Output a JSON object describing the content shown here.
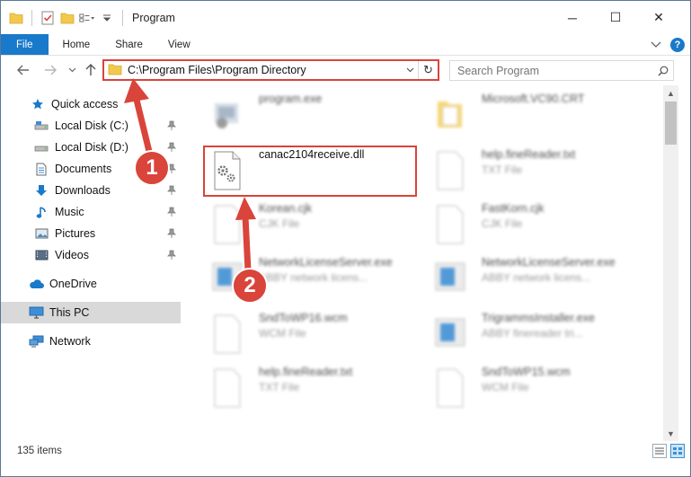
{
  "window": {
    "title": "Program",
    "controls": {
      "minimize": "─",
      "maximize": "☐",
      "close": "✕"
    }
  },
  "ribbon": {
    "tabs": [
      {
        "label": "File"
      },
      {
        "label": "Home"
      },
      {
        "label": "Share"
      },
      {
        "label": "View"
      }
    ]
  },
  "address": {
    "path": "C:\\Program Files\\Program Directory",
    "refresh_glyph": "↻"
  },
  "search": {
    "placeholder": "Search Program"
  },
  "sidebar": {
    "items": [
      {
        "label": "Quick access",
        "icon": "star-icon",
        "pinned": false
      },
      {
        "label": "Local Disk (C:)",
        "icon": "drive-icon",
        "pinned": true
      },
      {
        "label": "Local Disk (D:)",
        "icon": "drive-icon",
        "pinned": true
      },
      {
        "label": "Documents",
        "icon": "documents-icon",
        "pinned": true
      },
      {
        "label": "Downloads",
        "icon": "download-icon",
        "pinned": true
      },
      {
        "label": "Music",
        "icon": "music-icon",
        "pinned": true
      },
      {
        "label": "Pictures",
        "icon": "pictures-icon",
        "pinned": true
      },
      {
        "label": "Videos",
        "icon": "videos-icon",
        "pinned": true
      },
      {
        "label": "OneDrive",
        "icon": "cloud-icon",
        "pinned": false
      },
      {
        "label": "This PC",
        "icon": "computer-icon",
        "pinned": false,
        "selected": true
      },
      {
        "label": "Network",
        "icon": "network-icon",
        "pinned": false
      }
    ]
  },
  "files": [
    {
      "name": "program.exe",
      "type": "",
      "icon": "exe-icon"
    },
    {
      "name": "Microsoft.VC90.CRT",
      "type": "",
      "icon": "folder-icon"
    },
    {
      "name": "canac2104receive.dll",
      "type": "",
      "icon": "dll-icon",
      "highlighted": true
    },
    {
      "name": "help.fineReader.txt",
      "type": "TXT File",
      "icon": "text-file-icon"
    },
    {
      "name": "Korean.cjk",
      "type": "CJK File",
      "icon": "file-icon"
    },
    {
      "name": "FastKorn.cjk",
      "type": "CJK File",
      "icon": "file-icon"
    },
    {
      "name": "NetworkLicenseServer.exe",
      "type": "ABBY network licens...",
      "icon": "app-icon"
    },
    {
      "name": "NetworkLicenseServer.exe",
      "type": "ABBY network licens...",
      "icon": "app-icon"
    },
    {
      "name": "SndToWP16.wcm",
      "type": "WCM File",
      "icon": "file-icon"
    },
    {
      "name": "TrigrammsInstaller.exe",
      "type": "ABBY finereader tri...",
      "icon": "app-icon"
    },
    {
      "name": "help.fineReader.txt",
      "type": "TXT File",
      "icon": "text-file-icon"
    },
    {
      "name": "SndToWP15.wcm",
      "type": "WCM File",
      "icon": "file-icon"
    }
  ],
  "status": {
    "item_count": "135 items"
  },
  "annotations": {
    "step1": "1",
    "step2": "2",
    "color": "#d9443b"
  }
}
